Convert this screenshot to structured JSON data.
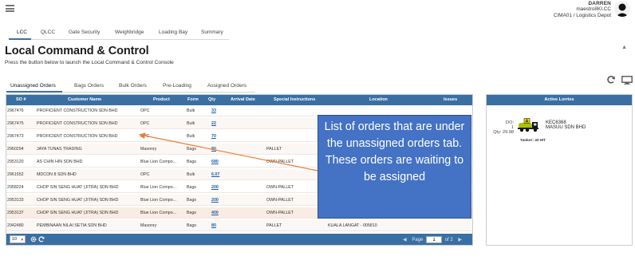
{
  "header": {
    "user_name": "DARREN",
    "user_login": "maestro8KI.CC",
    "location": "CIMA01 / Logistics Depot"
  },
  "subnav": {
    "tabs": [
      "LCC",
      "QLCC",
      "Gate Security",
      "Weighbridge",
      "Loading Bay",
      "Summary"
    ],
    "active": "LCC"
  },
  "page": {
    "title": "Local Command & Control",
    "subtitle": "Press the button below to launch the Local Command & Control Console"
  },
  "order_tabs": {
    "tabs": [
      "Unassigned Orders",
      "Bags Orders",
      "Bulk Orders",
      "Pre-Loading",
      "Assigned Orders"
    ],
    "active": "Unassigned Orders"
  },
  "grid": {
    "columns": [
      "SO #",
      "Customer Name",
      "Product",
      "Form",
      "Qty",
      "Arrival Date",
      "Special Instructions",
      "Location",
      "Issues"
    ],
    "rows": [
      {
        "so": "2967476",
        "customer": "PROFICIENT CONSTRUCTION SDN BHD",
        "product": "OPC",
        "form": "Bulk",
        "qty": "33",
        "arrival": "",
        "instructions": "",
        "location": "",
        "issues": ""
      },
      {
        "so": "2967475",
        "customer": "PROFICIENT CONSTRUCTION SDN BHD",
        "product": "OPC",
        "form": "Bulk",
        "qty": "22",
        "arrival": "",
        "instructions": "",
        "location": "",
        "issues": ""
      },
      {
        "so": "2967473",
        "customer": "PROFICIENT CONSTRUCTION SDN BHD",
        "product": "OPC",
        "form": "Bulk",
        "qty": "70",
        "arrival": "",
        "instructions": "",
        "location": "",
        "issues": ""
      },
      {
        "so": "2960294",
        "customer": "JAYA TUNAS TRADING",
        "product": "Masonry",
        "form": "Bags",
        "qty": "80",
        "arrival": "",
        "instructions": "PALLET",
        "location": "",
        "issues": ""
      },
      {
        "so": "2953120",
        "customer": "AS CHIN HIN SDN BHD",
        "product": "Blue Lion Compo...",
        "form": "Bags",
        "qty": "680",
        "arrival": "",
        "instructions": "OWN-PALLET",
        "location": "",
        "issues": ""
      },
      {
        "so": "2961552",
        "customer": "MDCON 8 SDN BHD",
        "product": "OPC",
        "form": "Bulk",
        "qty": "6.07",
        "arrival": "",
        "instructions": "",
        "location": "",
        "issues": ""
      },
      {
        "so": "2958224",
        "customer": "CHOP SIN SENG HUAT (JITRA) SDN BHD",
        "product": "Blue Lion Compo...",
        "form": "Bags",
        "qty": "200",
        "arrival": "",
        "instructions": "OWN-PALLET",
        "location": "",
        "issues": ""
      },
      {
        "so": "2953133",
        "customer": "CHOP SIN SENG HUAT (JITRA) SDN BHD",
        "product": "Blue Lion Compo...",
        "form": "Bags",
        "qty": "200",
        "arrival": "",
        "instructions": "OWN-PALLET",
        "location": "",
        "issues": ""
      },
      {
        "so": "2953137",
        "customer": "CHOP SIN SENG HUAT (JITRA) SDN BHD",
        "product": "Blue Lion Compo...",
        "form": "Bags",
        "qty": "400",
        "arrival": "",
        "instructions": "OWN-PALLET",
        "location": "",
        "issues": ""
      },
      {
        "so": "2942480",
        "customer": "PEMBINAAN NILAI SETIA SDN BHD",
        "product": "Masonry",
        "form": "Bags",
        "qty": "80",
        "arrival": "",
        "instructions": "PALLET",
        "location": "KUALA LANGAT - 005810",
        "issues": ""
      }
    ],
    "footer": {
      "page_size": "10",
      "page_label": "Page",
      "current_page": "1",
      "of_pages": "of 2"
    }
  },
  "lorries": {
    "title": "Active Lorries",
    "items": [
      {
        "do_label": "DO:",
        "do_value": "1",
        "qty": "Qty: 29.98",
        "plate": "KEC6368",
        "company": "MASUU SDN BHD",
        "tanker": "Tanker: 40 MT",
        "badge": "A"
      }
    ]
  },
  "annotation": {
    "text": "List of orders that are under the unassigned orders tab. These orders are waiting to be assigned"
  },
  "colors": {
    "header_blue": "#3a6fa3",
    "callout_blue": "#4472c4",
    "arrow_orange": "#ed7d31",
    "link_blue": "#1a5ea8"
  }
}
